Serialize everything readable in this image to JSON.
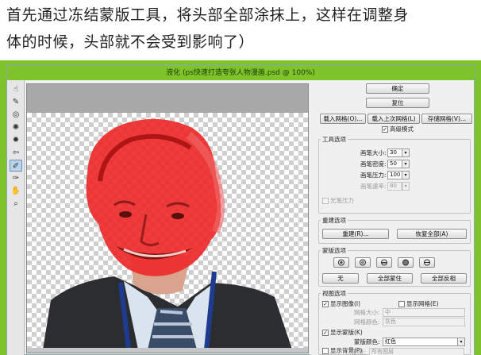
{
  "caption": {
    "line1": "首先通过冻结蒙版工具，将头部全部涂抹上，这样在调整身",
    "line2": "体的时候，头部就不会受到影响了）"
  },
  "window": {
    "title": "液化 (ps快速打造夸张人物漫画.psd @ 100%)"
  },
  "tools": [
    {
      "icon": "forward-warp-icon",
      "glyph": "☝"
    },
    {
      "icon": "reconstruct-icon",
      "glyph": "✎"
    },
    {
      "icon": "twirl-icon",
      "glyph": "◎"
    },
    {
      "icon": "pucker-icon",
      "glyph": "✺"
    },
    {
      "icon": "bloat-icon",
      "glyph": "✹"
    },
    {
      "icon": "push-left-icon",
      "glyph": "⇦"
    },
    {
      "icon": "freeze-mask-icon",
      "glyph": "✐"
    },
    {
      "icon": "thaw-mask-icon",
      "glyph": "✑"
    },
    {
      "icon": "hand-icon",
      "glyph": "✋"
    },
    {
      "icon": "zoom-icon",
      "glyph": "⌕"
    }
  ],
  "buttons": {
    "ok": "确定",
    "reset": "复位",
    "load_mesh": "载入网格(O)...",
    "load_last_mesh": "载入上次网格(L)",
    "save_mesh": "存储网格(V)...",
    "advanced_mode": "高级模式"
  },
  "tool_options": {
    "title": "工具选项",
    "rows": [
      {
        "label": "画笔大小:",
        "value": "30"
      },
      {
        "label": "画笔密度:",
        "value": "50"
      },
      {
        "label": "画笔压力:",
        "value": "100"
      },
      {
        "label": "画笔速率:",
        "value": "80"
      }
    ],
    "stylus": "光笔压力"
  },
  "reconstruct_options": {
    "title": "重建选项",
    "reconstruct": "重建(R)...",
    "restore_all": "恢复全部(A)"
  },
  "mask_options": {
    "title": "蒙版选项",
    "none": "无",
    "mask_all": "全部蒙住",
    "invert_all": "全部反相"
  },
  "view_options": {
    "title": "视图选项",
    "show_image": "显示图像(I)",
    "show_mesh": "显示网格(E)",
    "mesh_size_label": "网格大小:",
    "mesh_size_value": "中",
    "mesh_color_label": "网格颜色:",
    "mesh_color_value": "灰色",
    "show_mask": "显示蒙版(K)",
    "mask_color_label": "蒙版颜色:",
    "mask_color_value": "红色",
    "show_backdrop": "显示背景(P)",
    "use_label": "使用:",
    "use_value": "所有图层"
  },
  "colors": {
    "title_bar": "#7fc32a",
    "mask": "#ee2a2a"
  }
}
